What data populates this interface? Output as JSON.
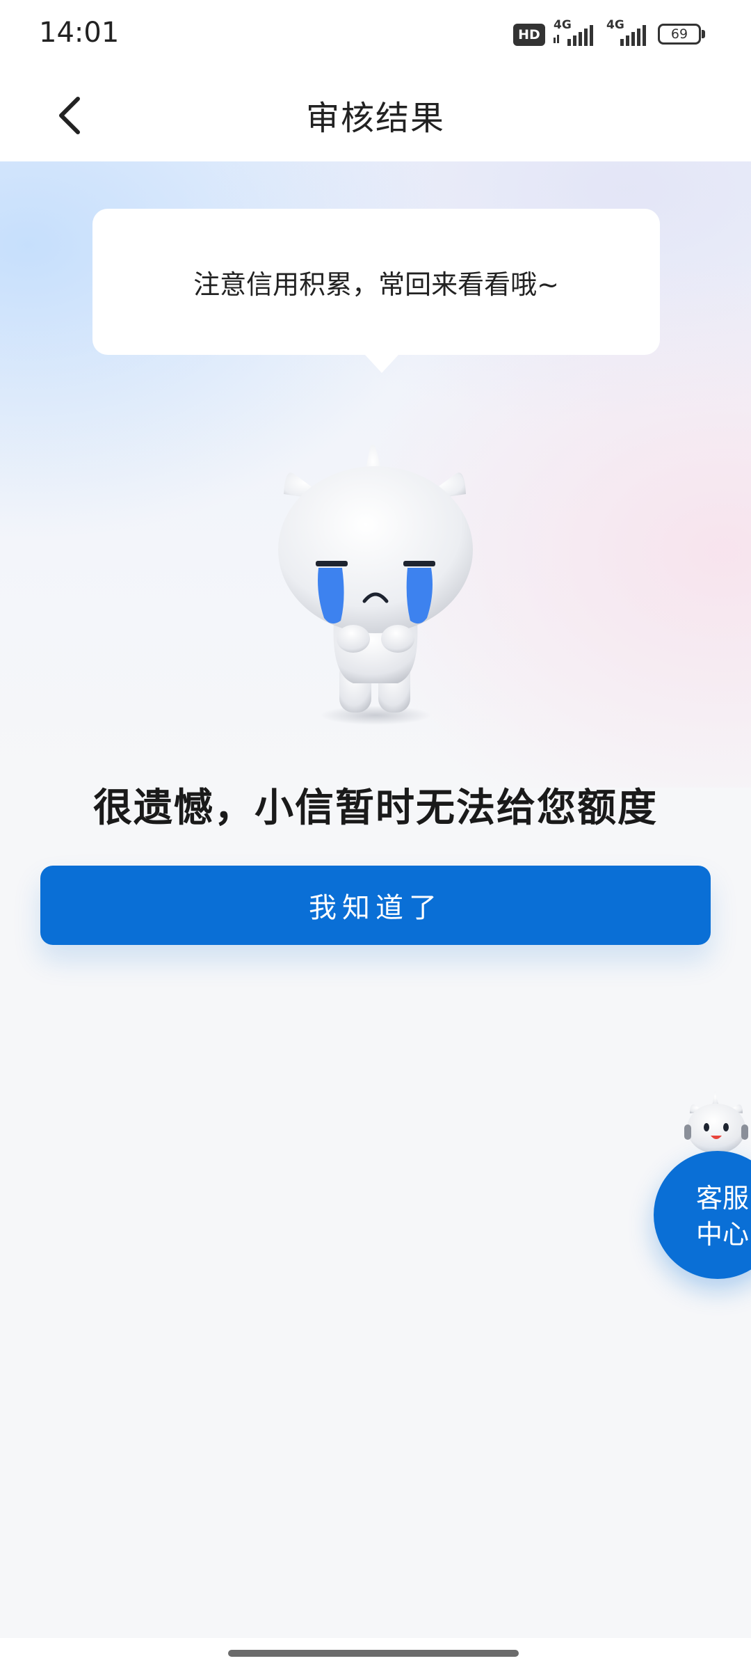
{
  "status_bar": {
    "time": "14:01",
    "hd_label": "HD",
    "network_1": "4G",
    "network_2": "4G",
    "battery": "69"
  },
  "nav": {
    "title": "审核结果"
  },
  "speech_bubble": {
    "text": "注意信用积累，常回来看看哦~"
  },
  "result": {
    "title": "很遗憾，小信暂时无法给您额度",
    "button_label": "我知道了"
  },
  "customer_service": {
    "line1": "客服",
    "line2": "中心"
  },
  "colors": {
    "primary": "#0a6fd6",
    "title_text": "#1a1a1a",
    "background": "#f6f7f9"
  }
}
